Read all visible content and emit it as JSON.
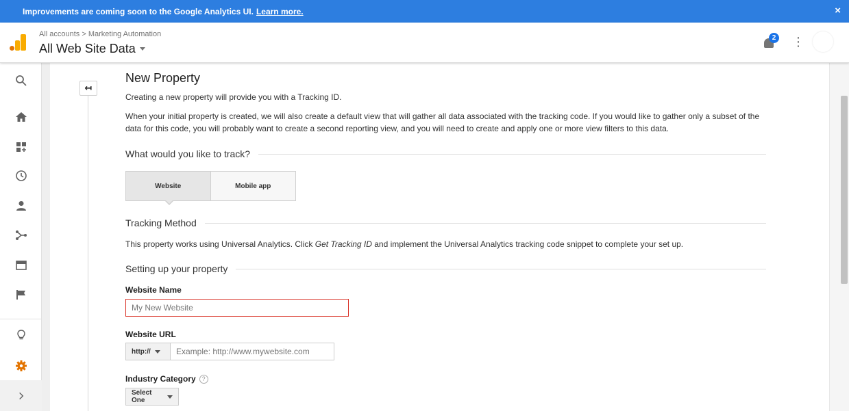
{
  "banner": {
    "text": "Improvements are coming soon to the Google Analytics UI.",
    "link": "Learn more.",
    "close": "×"
  },
  "header": {
    "breadcrumb": "All accounts > Marketing Automation",
    "title": "All Web Site Data",
    "notification_count": "2",
    "menu": "⋮"
  },
  "back_button": "↤",
  "page": {
    "title": "New Property",
    "intro": "Creating a new property will provide you with a Tracking ID.",
    "description": "When your initial property is created, we will also create a default view that will gather all data associated with the tracking code. If you would like to gather only a subset of the data for this code, you will probably want to create a second reporting view, and you will need to create and apply one or more view filters to this data.",
    "track_heading": "What would you like to track?",
    "track_options": [
      "Website",
      "Mobile app"
    ],
    "tracking_method_heading": "Tracking Method",
    "tracking_text_before": "This property works using Universal Analytics. Click ",
    "tracking_text_em": "Get Tracking ID",
    "tracking_text_after": " and implement the Universal Analytics tracking code snippet to complete your set up.",
    "setup_heading": "Setting up your property",
    "website_name_label": "Website Name",
    "website_name_placeholder": "My New Website",
    "website_url_label": "Website URL",
    "protocol": "http://",
    "website_url_placeholder": "Example: http://www.mywebsite.com",
    "industry_label": "Industry Category",
    "industry_help": "?",
    "industry_value": "Select One"
  },
  "colors": {
    "banner": "#2d7ee0",
    "accent_settings": "#e37400",
    "error_border": "#d93025"
  },
  "icons": [
    "search-icon",
    "home-icon",
    "dashboard-icon",
    "clock-icon",
    "person-icon",
    "acquisition-icon",
    "behavior-icon",
    "flag-icon",
    "lightbulb-icon",
    "gear-icon",
    "chevron-right-icon"
  ]
}
